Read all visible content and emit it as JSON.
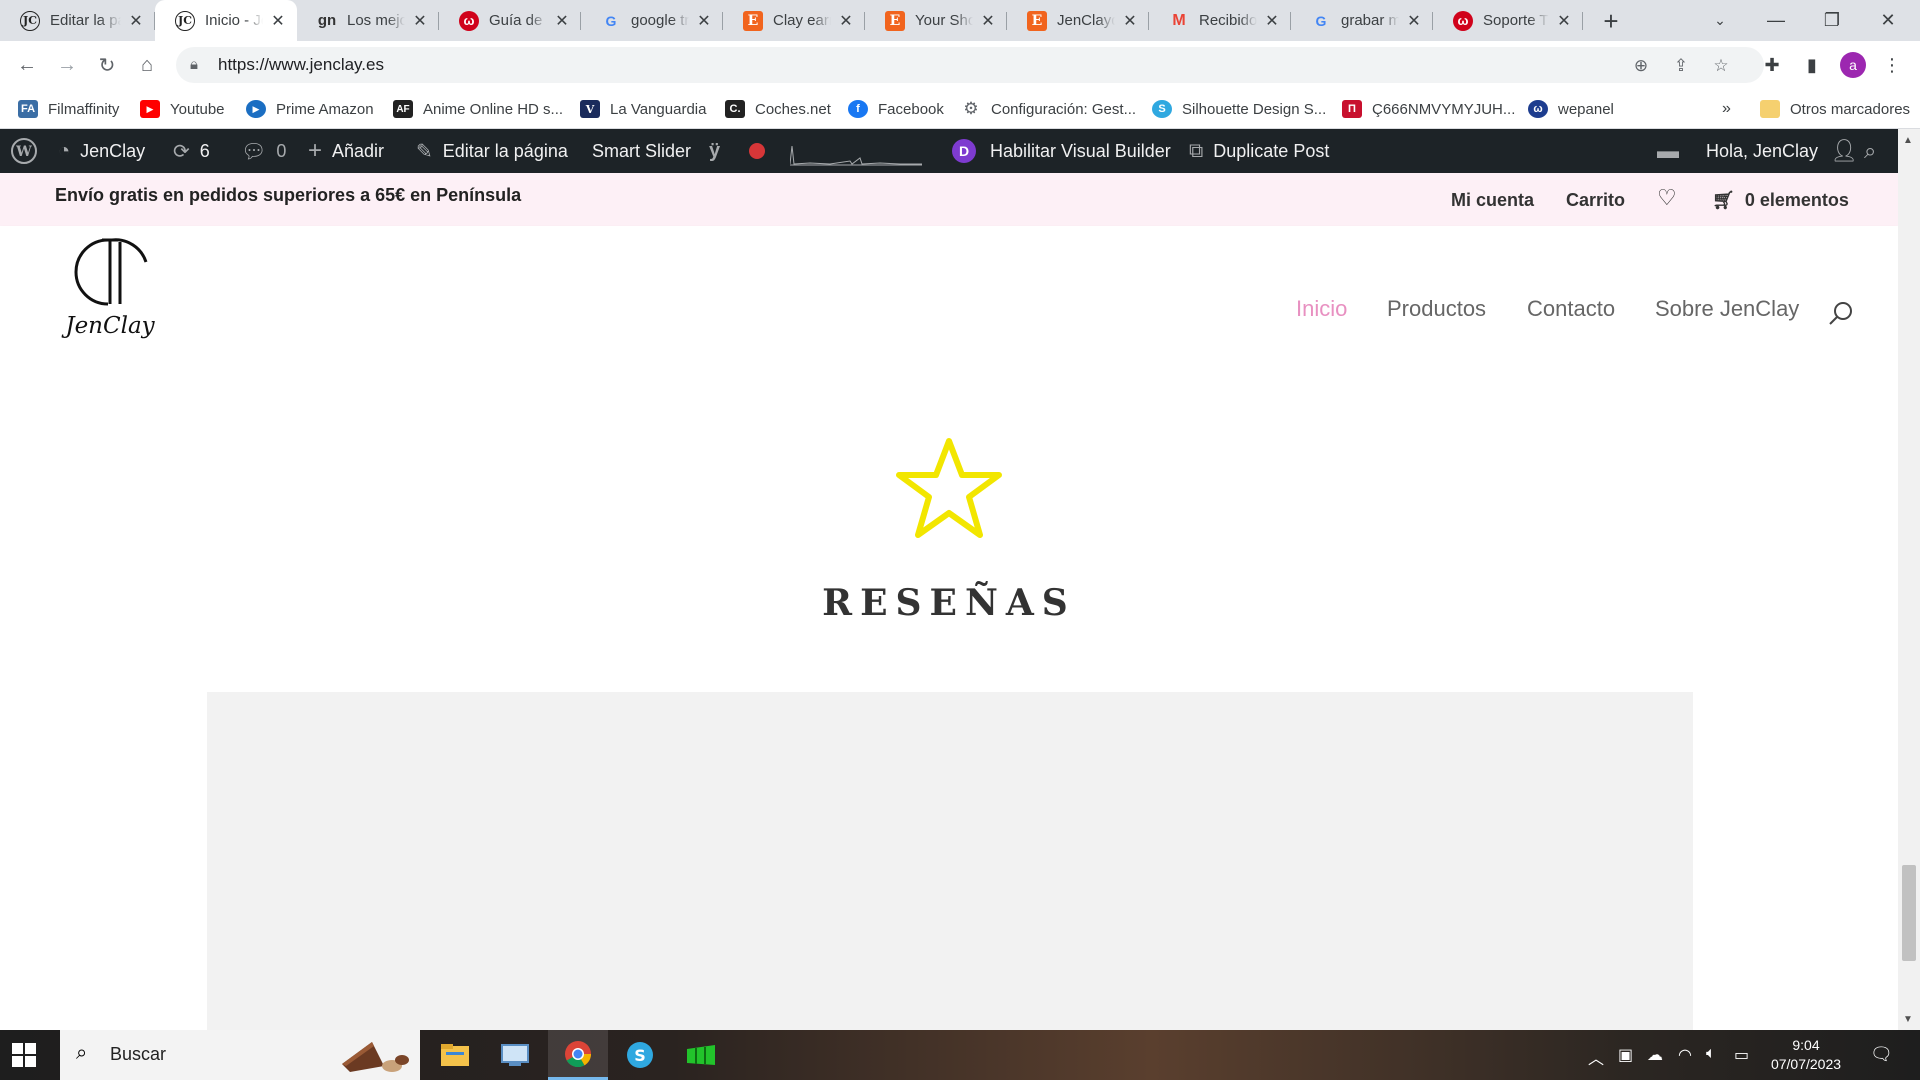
{
  "browser": {
    "tabs": [
      {
        "title": "Editar la página",
        "favicon": "jenclay-icon"
      },
      {
        "title": "Inicio - JenClay",
        "favicon": "jenclay-icon",
        "active": true
      },
      {
        "title": "Los mejores",
        "favicon": "gn-icon"
      },
      {
        "title": "Guía de a",
        "favicon": "webempresa-icon"
      },
      {
        "title": "google tr",
        "favicon": "google-icon"
      },
      {
        "title": "Clay earri",
        "favicon": "etsy-icon"
      },
      {
        "title": "Your Shop",
        "favicon": "etsy-icon"
      },
      {
        "title": "JenClayde",
        "favicon": "etsy-icon"
      },
      {
        "title": "Recibidos",
        "favicon": "gmail-icon"
      },
      {
        "title": "grabar m",
        "favicon": "google-icon"
      },
      {
        "title": "Soporte T",
        "favicon": "webempresa-icon"
      }
    ],
    "url": "https://www.jenclay.es",
    "profile_initial": "a",
    "bookmarks": [
      {
        "label": "Filmaffinity",
        "icon": "filmaffinity-icon"
      },
      {
        "label": "Youtube",
        "icon": "youtube-icon"
      },
      {
        "label": "Prime Amazon",
        "icon": "prime-icon"
      },
      {
        "label": "Anime Online HD s...",
        "icon": "animeflv-icon"
      },
      {
        "label": "La Vanguardia",
        "icon": "vanguardia-icon"
      },
      {
        "label": "Coches.net",
        "icon": "coches-icon"
      },
      {
        "label": "Facebook",
        "icon": "facebook-icon"
      },
      {
        "label": "Configuración: Gest...",
        "icon": "gear-icon"
      },
      {
        "label": "Silhouette Design S...",
        "icon": "silhouette-icon"
      },
      {
        "label": "Ç666NMVYMYJUH...",
        "icon": "bookmark-red-icon"
      },
      {
        "label": "wepanel",
        "icon": "wepanel-icon"
      }
    ],
    "overflow_chevron": "»",
    "other_bookmarks": "Otros marcadores"
  },
  "wp_admin": {
    "site_name": "JenClay",
    "updates_count": "6",
    "comments_count": "0",
    "add_label": "Añadir",
    "edit_label": "Editar la página",
    "smart_slider": "Smart Slider",
    "divi_logo": "D",
    "visual_builder": "Habilitar Visual Builder",
    "duplicate_post": "Duplicate Post",
    "greeting": "Hola, JenClay"
  },
  "site": {
    "promo": "Envío gratis en pedidos superiores a 65€ en Península",
    "my_account": "Mi cuenta",
    "cart": "Carrito",
    "cart_items": "0 elementos",
    "logo_text": "JenClay",
    "menu": [
      "Inicio",
      "Productos",
      "Contacto",
      "Sobre JenClay"
    ],
    "section_title": "RESEÑAS",
    "accent_color": "#e890c1",
    "star_color": "#f2e600"
  },
  "taskbar": {
    "search_placeholder": "Buscar",
    "time": "9:04",
    "date": "07/07/2023"
  }
}
